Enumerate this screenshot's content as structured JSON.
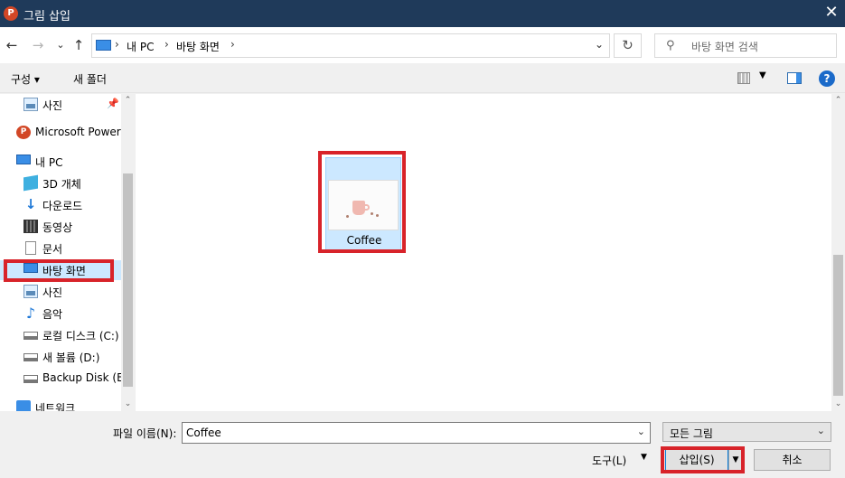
{
  "window": {
    "title": "그림 삽입",
    "app_icon": "P",
    "close": "✕"
  },
  "nav": {
    "back": "←",
    "forward": "→",
    "recent": "⌄",
    "up": "↑",
    "breadcrumb": [
      "내 PC",
      "바탕 화면"
    ],
    "refresh": "↻",
    "search_placeholder": "바탕 화면 검색"
  },
  "toolbar": {
    "organize": "구성 ▾",
    "new_folder": "새 폴더",
    "help": "?"
  },
  "sidebar": {
    "items": [
      {
        "label": "사진",
        "icon": "photos-icon"
      },
      {
        "label": "Microsoft PowerP",
        "icon": "powerpoint-icon"
      },
      {
        "label": "내 PC",
        "icon": "this-pc-icon"
      },
      {
        "label": "3D 개체",
        "icon": "3d-objects-icon"
      },
      {
        "label": "다운로드",
        "icon": "downloads-icon"
      },
      {
        "label": "동영상",
        "icon": "videos-icon"
      },
      {
        "label": "문서",
        "icon": "documents-icon"
      },
      {
        "label": "바탕 화면",
        "icon": "desktop-icon",
        "selected": true
      },
      {
        "label": "사진",
        "icon": "photos-icon"
      },
      {
        "label": "음악",
        "icon": "music-icon"
      },
      {
        "label": "로컬 디스크 (C:)",
        "icon": "drive-icon"
      },
      {
        "label": "새 볼륨 (D:)",
        "icon": "drive-icon"
      },
      {
        "label": "Backup Disk (E:)",
        "icon": "drive-icon"
      },
      {
        "label": "네트워크",
        "icon": "network-icon"
      }
    ]
  },
  "files": [
    {
      "name": "Coffee",
      "selected": true
    }
  ],
  "bottom": {
    "filename_label": "파일 이름(N):",
    "filename_value": "Coffee",
    "filetype_value": "모든 그림",
    "tools_label": "도구(L)",
    "insert_label": "삽입(S)",
    "cancel_label": "취소"
  },
  "colors": {
    "titlebar": "#1f3a5a",
    "selection": "#cce8ff",
    "highlight": "#d8232a"
  }
}
